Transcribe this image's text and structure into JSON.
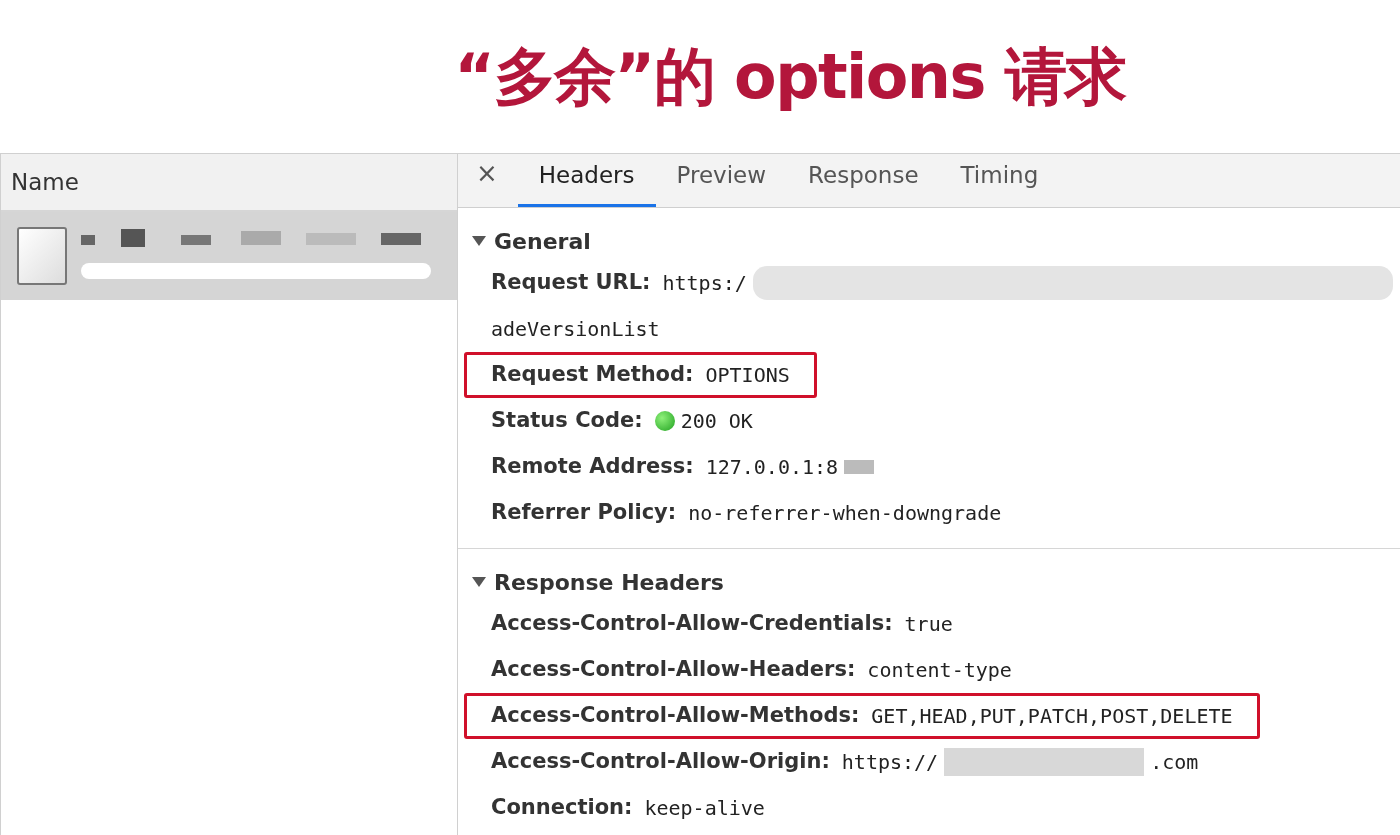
{
  "slide_title": "“多余”的 options 请求",
  "requests_panel": {
    "column": "Name",
    "rows": [
      {
        "selected": true
      }
    ]
  },
  "tabs": [
    {
      "label": "Headers",
      "selected": true
    },
    {
      "label": "Preview",
      "selected": false
    },
    {
      "label": "Response",
      "selected": false
    },
    {
      "label": "Timing",
      "selected": false
    }
  ],
  "close_icon": "×",
  "sections": [
    {
      "title": "General",
      "expanded": true,
      "rows": [
        {
          "name": "Request URL:",
          "highlighted": false,
          "value": [
            {
              "kind": "text",
              "text": "https:/"
            },
            {
              "kind": "redacted"
            }
          ]
        },
        {
          "name": "",
          "highlighted": false,
          "value": [
            {
              "kind": "text",
              "text": "adeVersionList"
            }
          ]
        },
        {
          "name": "Request Method:",
          "highlighted": true,
          "value": [
            {
              "kind": "text",
              "text": "OPTIONS"
            }
          ]
        },
        {
          "name": "Status Code:",
          "highlighted": false,
          "value": [
            {
              "kind": "status-dot"
            },
            {
              "kind": "text",
              "text": "200 OK"
            }
          ]
        },
        {
          "name": "Remote Address:",
          "highlighted": false,
          "value": [
            {
              "kind": "text",
              "text": "127.0.0.1:8"
            },
            {
              "kind": "redacted-short"
            }
          ]
        },
        {
          "name": "Referrer Policy:",
          "highlighted": false,
          "value": [
            {
              "kind": "text",
              "text": "no-referrer-when-downgrade"
            }
          ]
        }
      ]
    },
    {
      "title": "Response Headers",
      "expanded": true,
      "rows": [
        {
          "name": "Access-Control-Allow-Credentials:",
          "highlighted": false,
          "value": [
            {
              "kind": "text",
              "text": "true"
            }
          ]
        },
        {
          "name": "Access-Control-Allow-Headers:",
          "highlighted": false,
          "value": [
            {
              "kind": "text",
              "text": "content-type"
            }
          ]
        },
        {
          "name": "Access-Control-Allow-Methods:",
          "highlighted": true,
          "value": [
            {
              "kind": "text",
              "text": "GET,HEAD,PUT,PATCH,POST,DELETE"
            }
          ]
        },
        {
          "name": "Access-Control-Allow-Origin:",
          "highlighted": false,
          "value": [
            {
              "kind": "text",
              "text": "https://"
            },
            {
              "kind": "redacted-medium"
            },
            {
              "kind": "text",
              "text": ".com"
            }
          ]
        },
        {
          "name": "Connection:",
          "highlighted": false,
          "value": [
            {
              "kind": "text",
              "text": "keep-alive"
            }
          ]
        }
      ]
    }
  ]
}
